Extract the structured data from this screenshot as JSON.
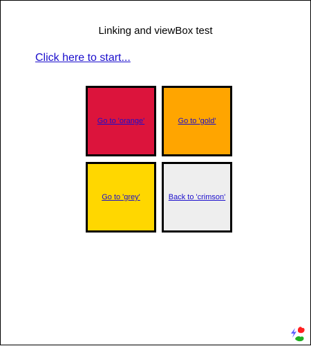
{
  "page": {
    "title": "Linking and viewBox test"
  },
  "start_link": {
    "label": "Click here to start..."
  },
  "tiles": [
    {
      "id": "crimson",
      "link_label": "Go to 'orange'",
      "fill": "#dc143c"
    },
    {
      "id": "orange",
      "link_label": "Go to 'gold'",
      "fill": "#ffa500"
    },
    {
      "id": "gold",
      "link_label": "Go to 'grey'",
      "fill": "#ffd700"
    },
    {
      "id": "grey",
      "link_label": "Back to 'crimson'",
      "fill": "#eeeeee"
    }
  ],
  "colors": {
    "link": "#1a0dcc",
    "border": "#000000"
  },
  "logo": {
    "icon": "svg-logo-icon"
  }
}
